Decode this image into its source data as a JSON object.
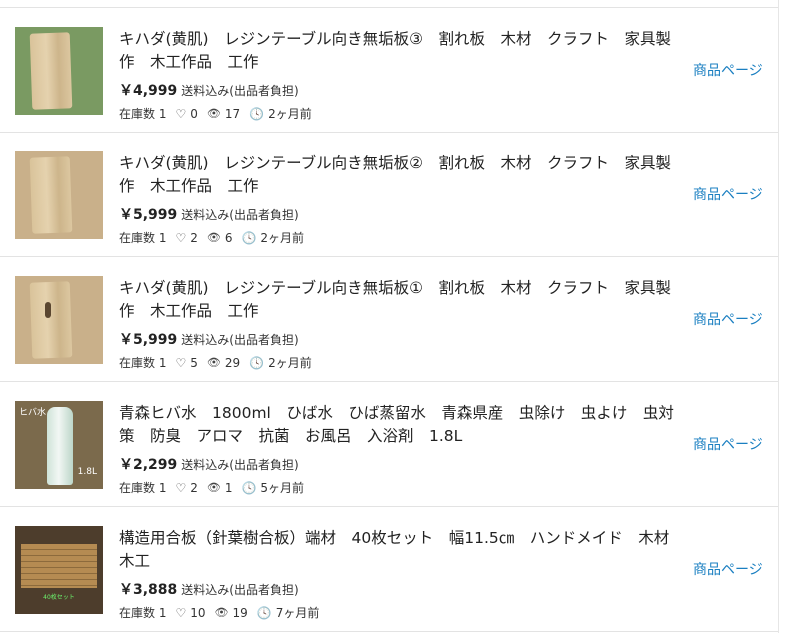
{
  "items": [
    {
      "title": "キハダ(黄肌)　レジンテーブル向き無垢板③　割れ板　木材　クラフト　家具製作　木工作品　工作",
      "price": "￥4,999",
      "shipping": "送料込み(出品者負担)",
      "stock_label": "在庫数 1",
      "likes": "0",
      "views": "17",
      "age": "2ヶ月前",
      "link": "商品ページ"
    },
    {
      "title": "キハダ(黄肌)　レジンテーブル向き無垢板②　割れ板　木材　クラフト　家具製作　木工作品　工作",
      "price": "￥5,999",
      "shipping": "送料込み(出品者負担)",
      "stock_label": "在庫数 1",
      "likes": "2",
      "views": "6",
      "age": "2ヶ月前",
      "link": "商品ページ"
    },
    {
      "title": "キハダ(黄肌)　レジンテーブル向き無垢板①　割れ板　木材　クラフト　家具製作　木工作品　工作",
      "price": "￥5,999",
      "shipping": "送料込み(出品者負担)",
      "stock_label": "在庫数 1",
      "likes": "5",
      "views": "29",
      "age": "2ヶ月前",
      "link": "商品ページ"
    },
    {
      "title": "青森ヒバ水　1800ml　ひば水　ひば蒸留水　青森県産　虫除け　虫よけ　虫対策　防臭　アロマ　抗菌　お風呂　入浴剤　1.8L",
      "price": "￥2,299",
      "shipping": "送料込み(出品者負担)",
      "stock_label": "在庫数 1",
      "likes": "2",
      "views": "1",
      "age": "5ヶ月前",
      "link": "商品ページ"
    },
    {
      "title": "構造用合板（針葉樹合板）端材　40枚セット　幅11.5㎝　ハンドメイド　木材　木工",
      "price": "￥3,888",
      "shipping": "送料込み(出品者負担)",
      "stock_label": "在庫数 1",
      "likes": "10",
      "views": "19",
      "age": "7ヶ月前",
      "link": "商品ページ"
    }
  ],
  "thumb_captions": {
    "bottle_top": "ヒバ水",
    "bottle_bottom": "1.8L",
    "plywood_bottom": "40枚セット"
  },
  "colors": {
    "link": "#1a7fc1",
    "border": "#e3e3e3"
  }
}
